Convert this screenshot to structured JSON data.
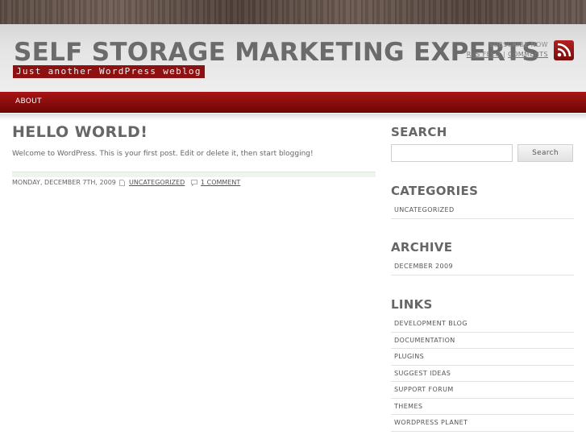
{
  "header": {
    "site_title": "SELF STORAGE MARKETING EXPERTS",
    "tagline": "Just another WordPress weblog",
    "subscribe_now": "SUBSCRIBE NOW",
    "rss_feed": "RSS FEED",
    "comments": "COMMENTS",
    "rss_icon": "rss-icon"
  },
  "nav": {
    "items": [
      {
        "label": "ABOUT"
      }
    ]
  },
  "post": {
    "title": "HELLO WORLD!",
    "body": "Welcome to WordPress. This is your first post. Edit or delete it, then start blogging!",
    "date": "MONDAY, DECEMBER 7TH, 2009",
    "category": "UNCATEGORIZED",
    "comments": "1 COMMENT",
    "category_icon": "document-icon",
    "comment_icon": "comment-icon"
  },
  "sidebar": {
    "search": {
      "title": "SEARCH",
      "placeholder": "",
      "value": "",
      "button": "Search"
    },
    "categories": {
      "title": "CATEGORIES",
      "items": [
        "UNCATEGORIZED"
      ]
    },
    "archive": {
      "title": "ARCHIVE",
      "items": [
        "DECEMBER 2009"
      ]
    },
    "links": {
      "title": "LINKS",
      "items": [
        "DEVELOPMENT BLOG",
        "DOCUMENTATION",
        "PLUGINS",
        "SUGGEST IDEAS",
        "SUPPORT FORUM",
        "THEMES",
        "WORDPRESS PLANET"
      ]
    }
  },
  "colors": {
    "accent": "#8e1111",
    "nav": "#9a1010",
    "heading": "#666666"
  }
}
